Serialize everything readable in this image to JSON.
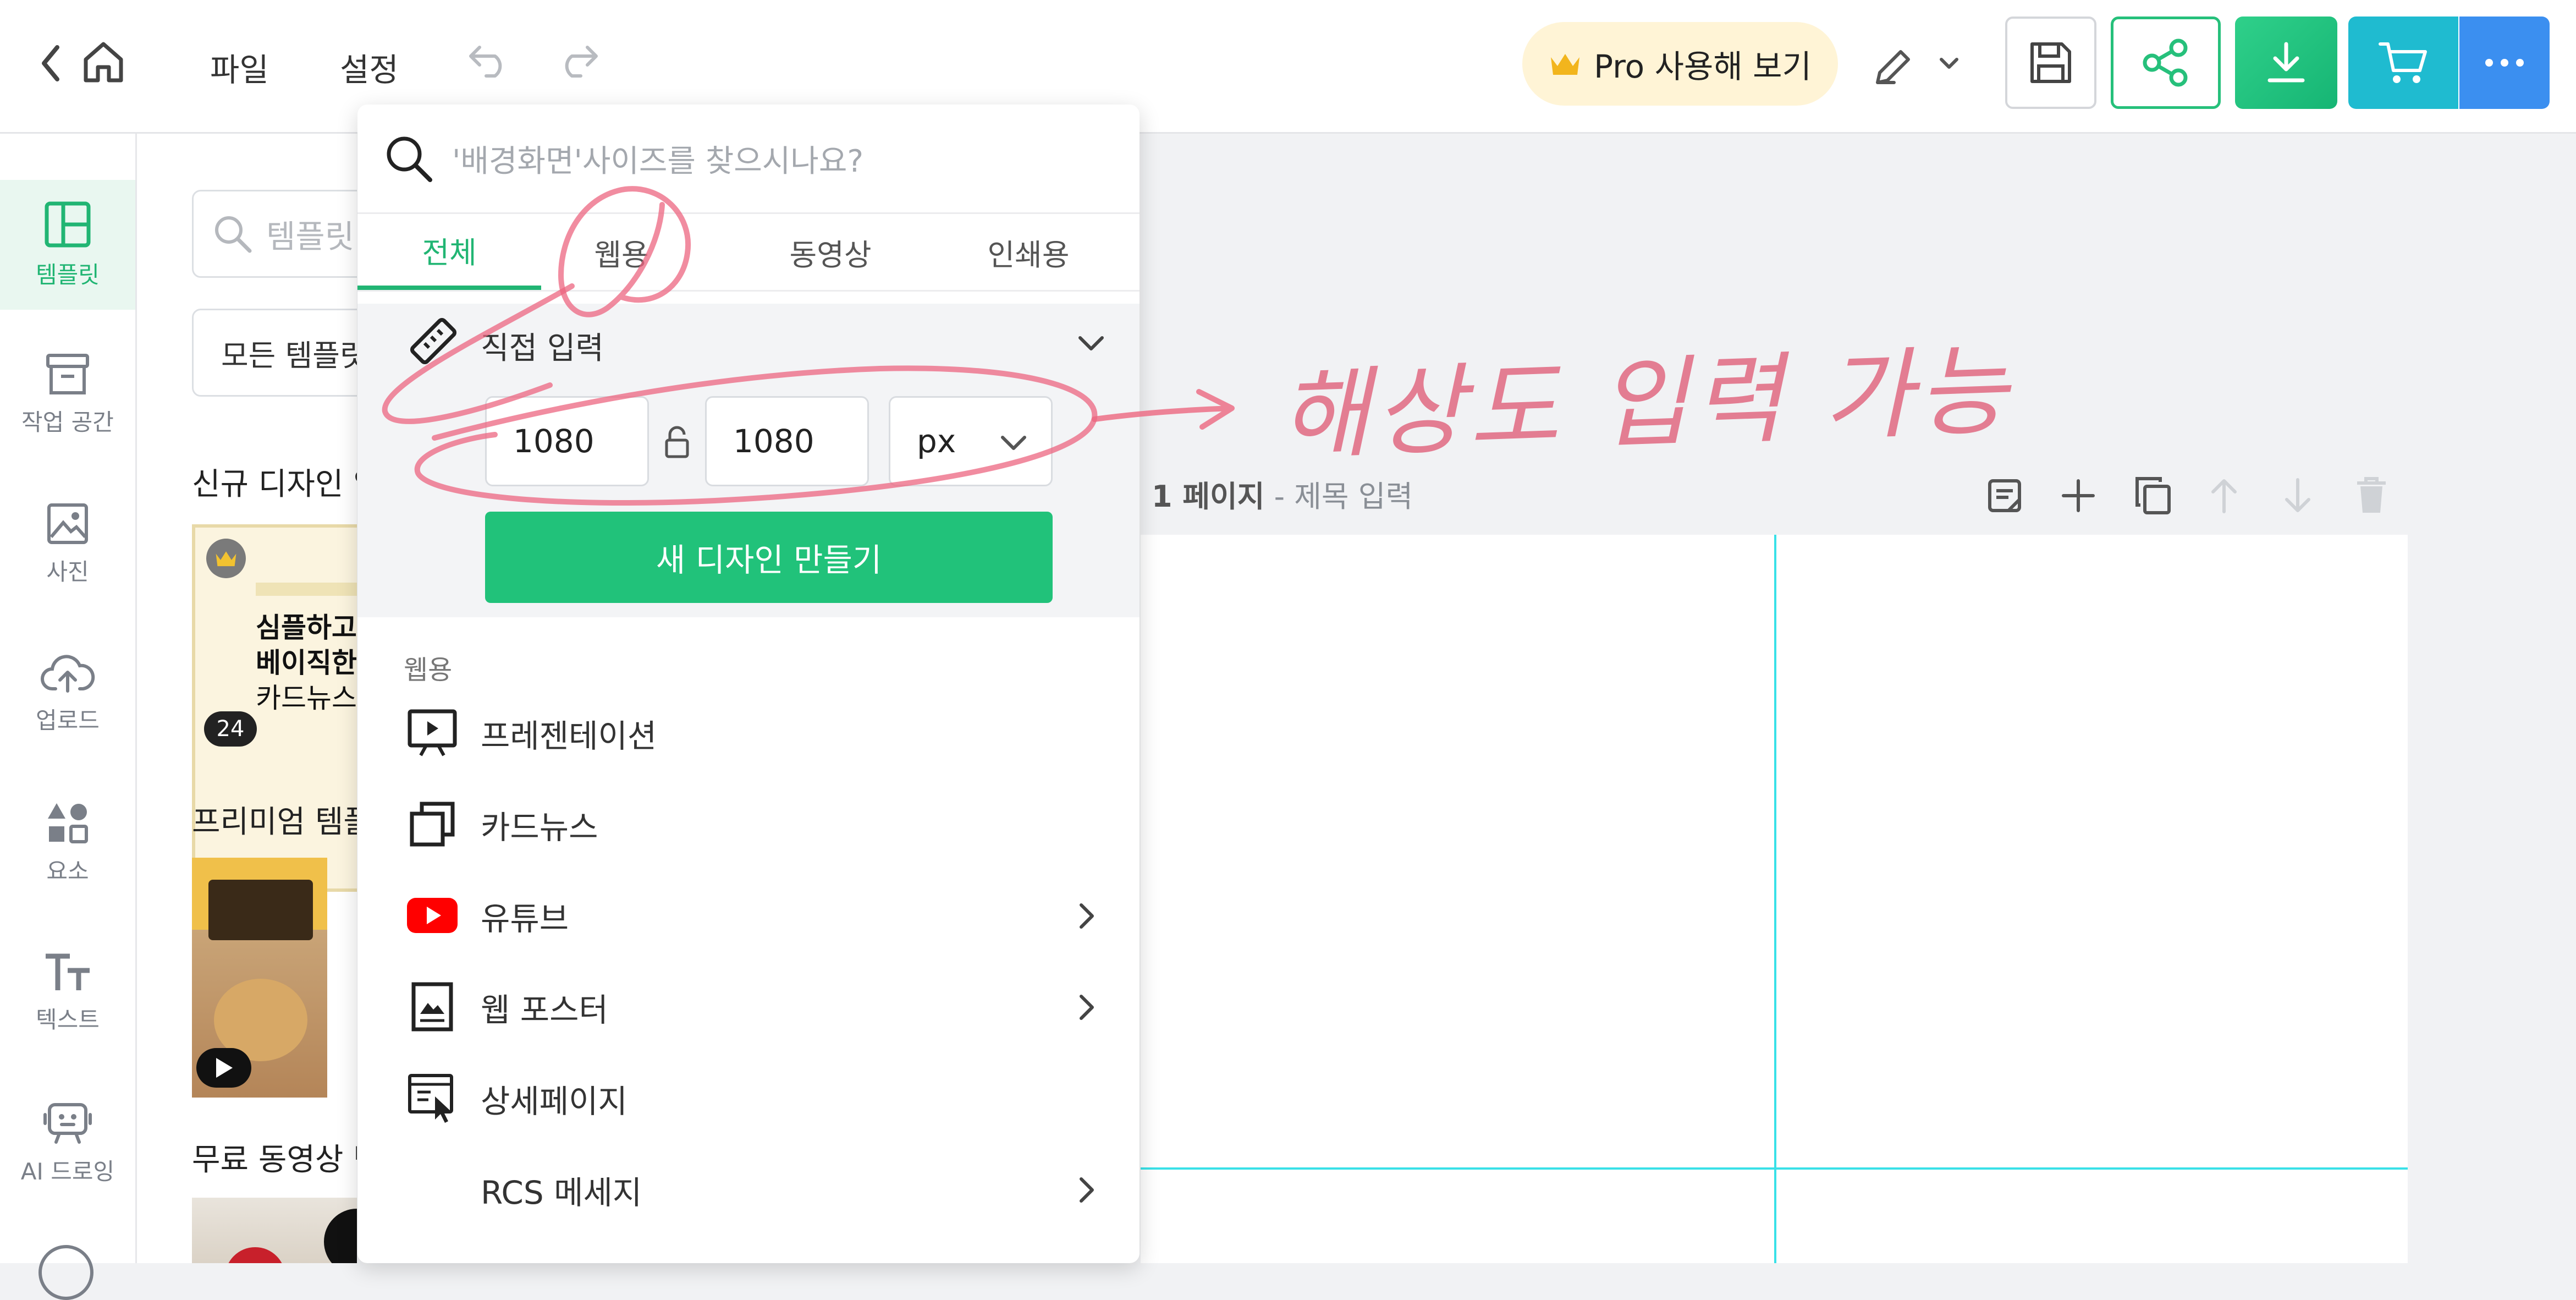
{
  "topbar": {
    "menu_file": "파일",
    "menu_settings": "설정",
    "pro_label": "Pro 사용해 보기"
  },
  "rail": [
    {
      "label": "템플릿",
      "icon": "template-layout-icon",
      "active": true
    },
    {
      "label": "작업 공간",
      "icon": "archive-box-icon"
    },
    {
      "label": "사진",
      "icon": "image-icon"
    },
    {
      "label": "업로드",
      "icon": "cloud-upload-icon"
    },
    {
      "label": "요소",
      "icon": "shapes-icon"
    },
    {
      "label": "텍스트",
      "icon": "text-icon"
    },
    {
      "label": "AI 드로잉",
      "icon": "ai-robot-icon"
    }
  ],
  "template_panel": {
    "search_placeholder": "템플릿",
    "select_value": "모든 템플릿",
    "section_new": "신규 디자인 입",
    "card_title_1": "심플하고",
    "card_title_2": "베이직한",
    "card_title_3": "카드뉴스",
    "card_count": "24",
    "section_premium": "프리미엄 템플",
    "section_free_video": "무료 동영상 템"
  },
  "canvas": {
    "page_number": "1 페이지",
    "separator": " - ",
    "title_placeholder": "제목 입력"
  },
  "dropdown": {
    "search_placeholder": "'배경화면'사이즈를 찾으시나요?",
    "tabs": [
      "전체",
      "웹용",
      "동영상",
      "인쇄용"
    ],
    "active_tab": 0,
    "custom_label": "직접 입력",
    "width_value": "1080",
    "height_value": "1080",
    "unit": "px",
    "create_label": "새 디자인 만들기",
    "section_label": "웹용",
    "items": [
      {
        "label": "프레젠테이션",
        "icon": "presentation-icon",
        "has_chevron": false
      },
      {
        "label": "카드뉴스",
        "icon": "card-stack-icon",
        "has_chevron": false
      },
      {
        "label": "유튜브",
        "icon": "youtube-icon",
        "has_chevron": true
      },
      {
        "label": "웹 포스터",
        "icon": "poster-icon",
        "has_chevron": true
      },
      {
        "label": "상세페이지",
        "icon": "detail-page-icon",
        "has_chevron": false
      },
      {
        "label": "RCS 메세지",
        "icon": "",
        "has_chevron": true
      }
    ]
  },
  "annotation_text": "해상도 입력 가능",
  "colors": {
    "accent_green": "#21c27a",
    "pro_bg": "#fff4d6",
    "cyan_button": "#1fbbd0",
    "blue_button": "#3b8ff0",
    "annotation": "#e0607a"
  }
}
